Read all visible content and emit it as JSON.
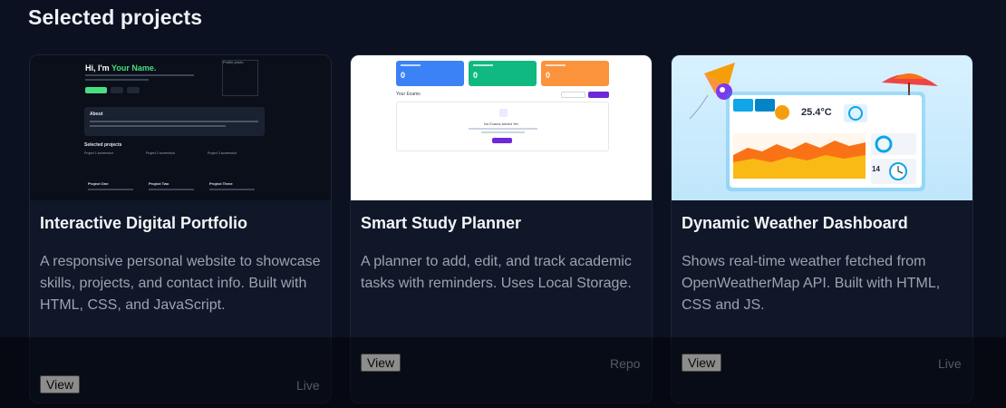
{
  "section": {
    "title": "Selected projects"
  },
  "projects": [
    {
      "title": "Interactive Digital Portfolio",
      "description": "A responsive personal website to showcase skills, projects, and contact info. Built with HTML, CSS, and JavaScript.",
      "view_label": "View",
      "link_label": "Live",
      "thumb": {
        "greeting": "Hi, I'm ",
        "name": "Your Name.",
        "photo_alt": "Profile photo",
        "about_title": "About",
        "selected_title": "Selected projects",
        "screenshots": [
          "Project 1 screenshot",
          "Project 2 screenshot",
          "Project 3 screenshot"
        ],
        "project_titles": [
          "Project One",
          "Project Two",
          "Project Three"
        ]
      }
    },
    {
      "title": "Smart Study Planner",
      "description": "A planner to add, edit, and track academic tasks with reminders. Uses Local Storage.",
      "view_label": "View",
      "link_label": "Repo",
      "thumb": {
        "stats": [
          "0",
          "0",
          "0"
        ],
        "stat_colors": [
          "#3b82f6",
          "#10b981",
          "#fb923c"
        ],
        "section_label": "Your Exams",
        "empty_title": "No Exams Added Yet"
      }
    },
    {
      "title": "Dynamic Weather Dashboard",
      "description": "Shows real-time weather fetched from OpenWeatherMap API. Built with HTML, CSS and JS.",
      "view_label": "View",
      "link_label": "Live",
      "thumb": {
        "temperature": "25.4°C",
        "clock": "14"
      }
    }
  ]
}
